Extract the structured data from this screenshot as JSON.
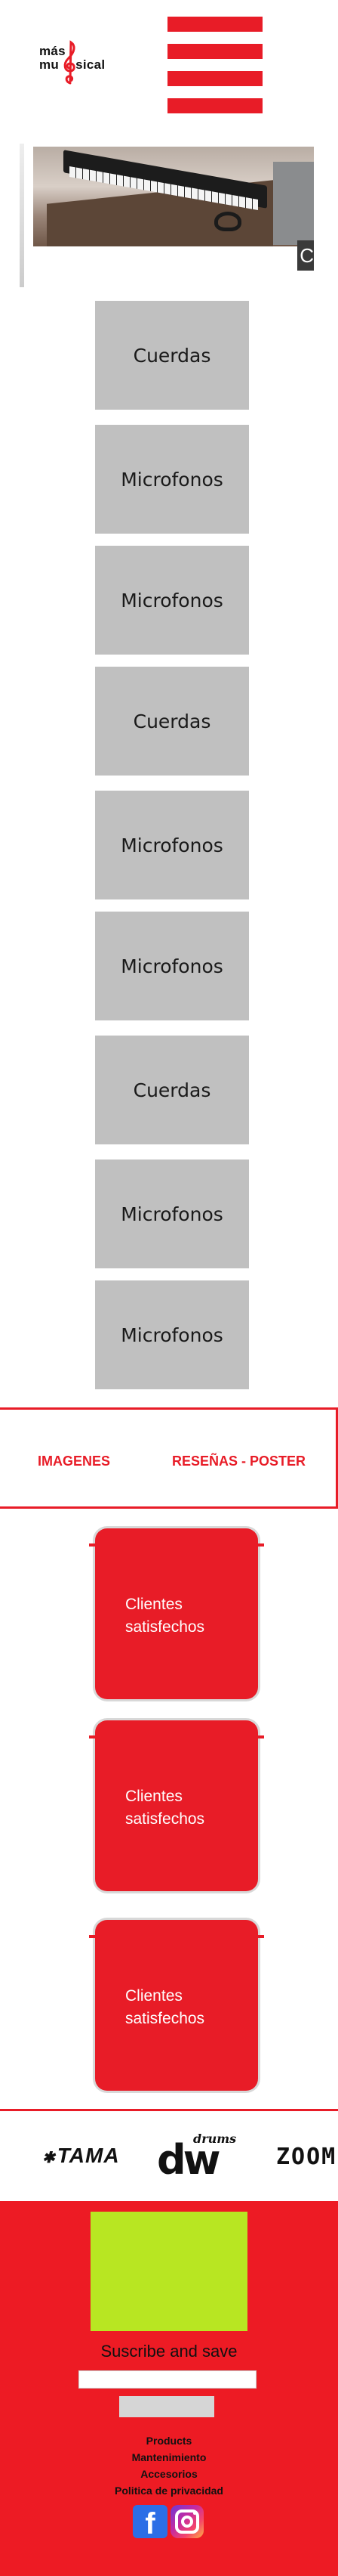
{
  "header": {
    "logo_line1": "más",
    "logo_line2": "mu",
    "logo_line2_rest": "sical",
    "menu_icon": "hamburger-icon",
    "accent_color": "#e81c27"
  },
  "hero": {
    "image": "piano-keyboard-photo",
    "badge_text": "C"
  },
  "categories": [
    {
      "label": "Cuerdas"
    },
    {
      "label": "Microfonos"
    },
    {
      "label": "Microfonos"
    },
    {
      "label": "Cuerdas"
    },
    {
      "label": "Microfonos"
    },
    {
      "label": "Microfonos"
    },
    {
      "label": "Cuerdas"
    },
    {
      "label": "Microfonos"
    },
    {
      "label": "Microfonos"
    }
  ],
  "tabs": {
    "images_label": "IMAGENES",
    "reviews_label": "RESEÑAS - POSTER"
  },
  "reviews": [
    {
      "line1": "Clientes",
      "line2": "satisfechos"
    },
    {
      "line1": "Clientes",
      "line2": "satisfechos"
    },
    {
      "line1": "Clientes",
      "line2": "satisfechos"
    }
  ],
  "brands": {
    "tama": "TAMA",
    "dw_small": "drums",
    "dw_big": "dw",
    "zoom": "ZOOM"
  },
  "footer": {
    "background_color": "#ed1b24",
    "promo_color": "#b8e622",
    "subscribe_title": "Suscribe and save",
    "email_placeholder": "",
    "submit_label": "",
    "links": [
      "Products",
      "Mantenimiento",
      "Accesorios",
      "Politica de privacidad"
    ],
    "facebook_icon": "facebook-icon",
    "instagram_icon": "instagram-icon"
  }
}
